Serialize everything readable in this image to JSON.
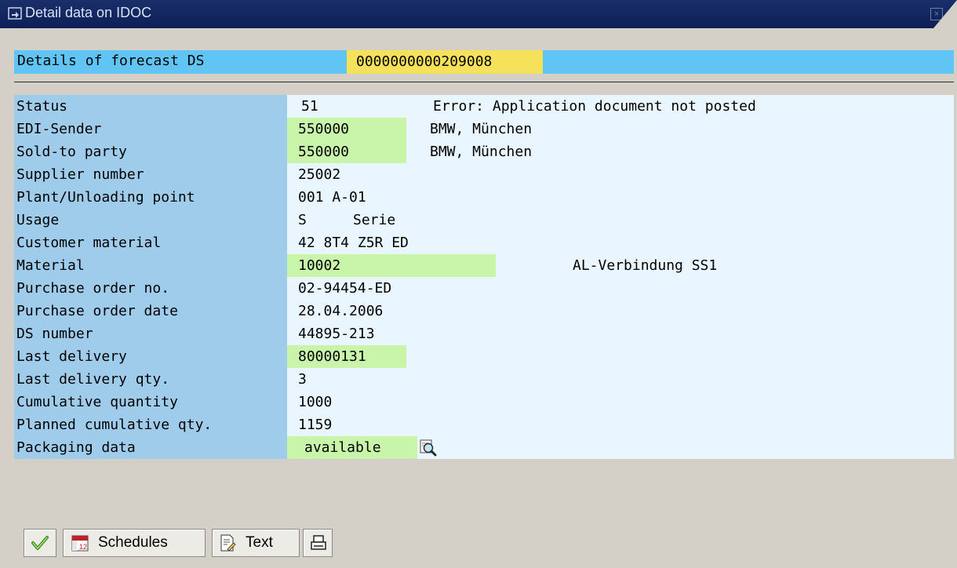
{
  "window": {
    "title": "Detail data on IDOC"
  },
  "header": {
    "label": "Details of forecast DS",
    "value": "0000000000209008"
  },
  "rows": [
    {
      "label": "Status",
      "code": "51",
      "desc": "Error: Application document not posted"
    },
    {
      "label": "EDI-Sender",
      "code": "550000",
      "desc": "BMW, München"
    },
    {
      "label": "Sold-to party",
      "code": "550000",
      "desc": "BMW, München"
    },
    {
      "label": "Supplier number",
      "code": "25002"
    },
    {
      "label": "Plant/Unloading point",
      "code": "001 A-01"
    },
    {
      "label": "Usage",
      "code": "S",
      "desc": "Serie"
    },
    {
      "label": "Customer material",
      "code": "42 8T4 Z5R ED"
    },
    {
      "label": "Material",
      "code": "10002",
      "desc": "AL-Verbindung SS1"
    },
    {
      "label": "Purchase order no.",
      "code": "02-94454-ED"
    },
    {
      "label": "Purchase order date",
      "code": "28.04.2006"
    },
    {
      "label": "DS number",
      "code": "44895-213"
    },
    {
      "label": "Last delivery",
      "code": "80000131"
    },
    {
      "label": "Last delivery qty.",
      "code": "3"
    },
    {
      "label": "Cumulative quantity",
      "code": "1000"
    },
    {
      "label": "Planned cumulative qty.",
      "code": "1159"
    },
    {
      "label": "Packaging data",
      "code": "available"
    }
  ],
  "toolbar": {
    "schedules_label": "Schedules",
    "text_label": "Text",
    "calendar_icon_text": "12"
  },
  "colors": {
    "label_bg": "#9fcceb",
    "value_bg": "#e9f5ff",
    "highlight": "#c8f5aa",
    "header_band": "#60c4f5",
    "header_value": "#f5e25a"
  }
}
